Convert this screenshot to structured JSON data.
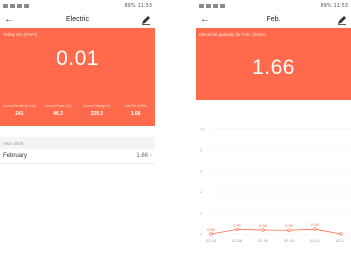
{
  "left": {
    "title": "Electric",
    "back_icon": "back-arrow-icon",
    "edit_icon": "pen-icon",
    "today_label": "Today Ele (KWH)",
    "today_value": "0.01",
    "stats": [
      {
        "label": "Current Electricity (mA)",
        "value": "241"
      },
      {
        "label": "Current Power (W)",
        "value": "46.2"
      },
      {
        "label": "Current Voltage (V)",
        "value": "229.2"
      },
      {
        "label": "Total Ele (KWH)",
        "value": "1.66"
      }
    ],
    "year_label": "Year 2019",
    "month_label": "February",
    "month_value": "1.66"
  },
  "right": {
    "title": "Feb.",
    "back_icon": "back-arrow-icon",
    "edit_icon": "pen-icon",
    "quantity_label": "Electrical quantity for Feb. (KWH)",
    "quantity_value": "1.66"
  },
  "status": {
    "battery": "89%",
    "time": "11:53"
  },
  "colors": {
    "accent": "#ff6a4d",
    "muted": "#9a9a9a"
  },
  "chart_data": {
    "type": "line",
    "y_ticks": [
      "10",
      "8",
      "6",
      "4",
      "2",
      "0"
    ],
    "ylim": [
      0,
      10
    ],
    "x": [
      "02-04",
      "02-08",
      "02-09",
      "02-10",
      "02-11",
      "02-1"
    ],
    "values": [
      0.0,
      0.44,
      0.38,
      0.36,
      0.46,
      0.0
    ],
    "point_labels": [
      "0.00",
      "0.44",
      "0.38",
      "0.36",
      "0.46",
      ""
    ],
    "grid": true,
    "color": "#ff6a4d"
  }
}
